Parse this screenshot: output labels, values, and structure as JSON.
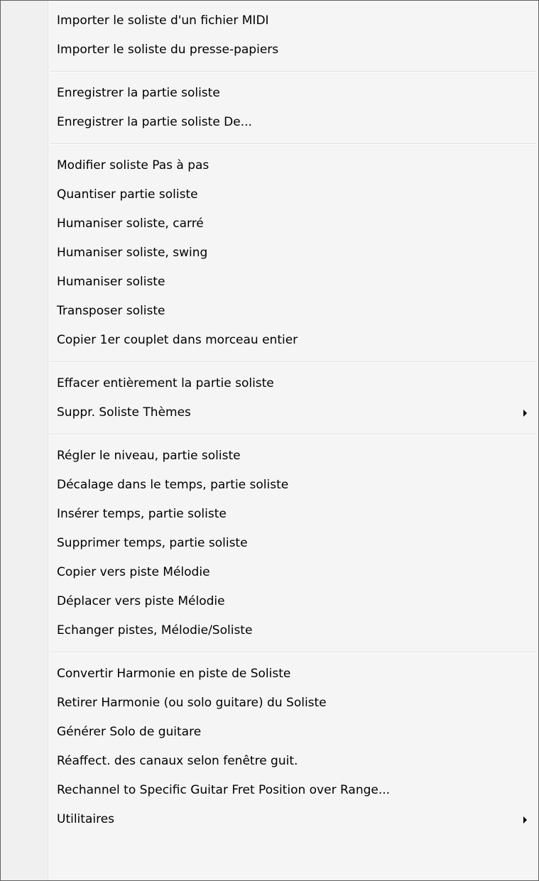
{
  "menu": {
    "items": [
      {
        "label": "Importer le soliste d'un fichier MIDI"
      },
      {
        "label": "Importer le soliste du presse-papiers"
      },
      {
        "label": "Enregistrer la partie soliste"
      },
      {
        "label": "Enregistrer la partie soliste De..."
      },
      {
        "label": "Modifier soliste Pas à pas"
      },
      {
        "label": "Quantiser partie soliste"
      },
      {
        "label": "Humaniser soliste, carré"
      },
      {
        "label": "Humaniser soliste, swing"
      },
      {
        "label": "Humaniser soliste"
      },
      {
        "label": "Transposer soliste"
      },
      {
        "label": "Copier 1er couplet dans morceau entier"
      },
      {
        "label": "Effacer entièrement la partie soliste"
      },
      {
        "label": "Suppr. Soliste Thèmes",
        "submenu_icon": "submenu-arrow-icon"
      },
      {
        "label": "Régler le niveau, partie soliste"
      },
      {
        "label": "Décalage dans le temps, partie soliste"
      },
      {
        "label": "Insérer temps, partie soliste"
      },
      {
        "label": "Supprimer temps, partie soliste"
      },
      {
        "label": "Copier vers piste Mélodie"
      },
      {
        "label": "Déplacer vers piste Mélodie"
      },
      {
        "label": "Echanger pistes, Mélodie/Soliste"
      },
      {
        "label": "Convertir Harmonie en piste de Soliste"
      },
      {
        "label": "Retirer Harmonie (ou solo guitare) du Soliste"
      },
      {
        "label": "Générer Solo de guitare"
      },
      {
        "label": "Réaffect. des canaux selon fenêtre guit."
      },
      {
        "label": "Rechannel to Specific Guitar Fret Position over Range..."
      },
      {
        "label": "Utilitaires",
        "submenu_icon": "submenu-arrow-icon"
      }
    ]
  },
  "colors": {
    "menu_background": "#f5f5f5",
    "border": "#5f5f5f",
    "separator": "#e0e0e0"
  }
}
